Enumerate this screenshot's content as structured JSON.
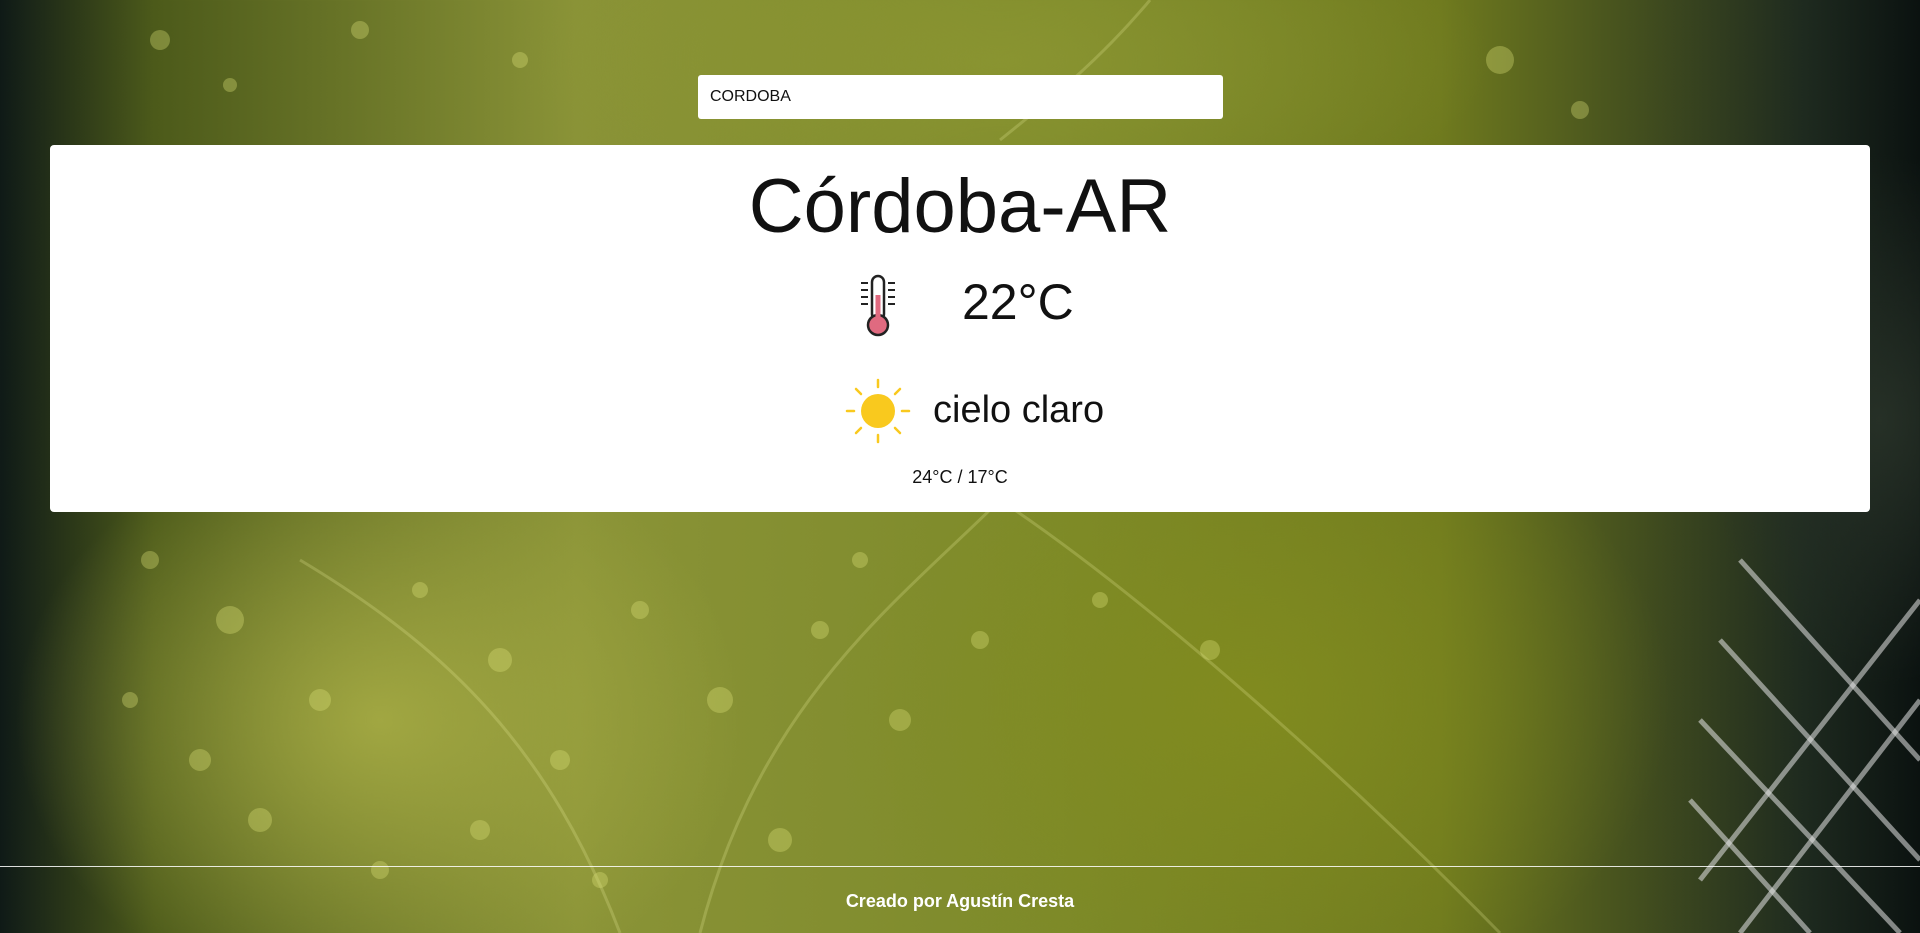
{
  "search": {
    "value": "CORDOBA"
  },
  "weather": {
    "city": "Córdoba-AR",
    "temperature": "22°C",
    "temperature_icon": "thermometer-icon",
    "description": "cielo claro",
    "condition_icon": "sun-icon",
    "min_max": "24°C / 17°C"
  },
  "footer": {
    "text": "Creado por Agustín Cresta"
  },
  "colors": {
    "card_background": "#ffffff",
    "sun": "#f9c91e",
    "thermometer_fill": "#e06a80",
    "footer_text": "#ffffff"
  }
}
